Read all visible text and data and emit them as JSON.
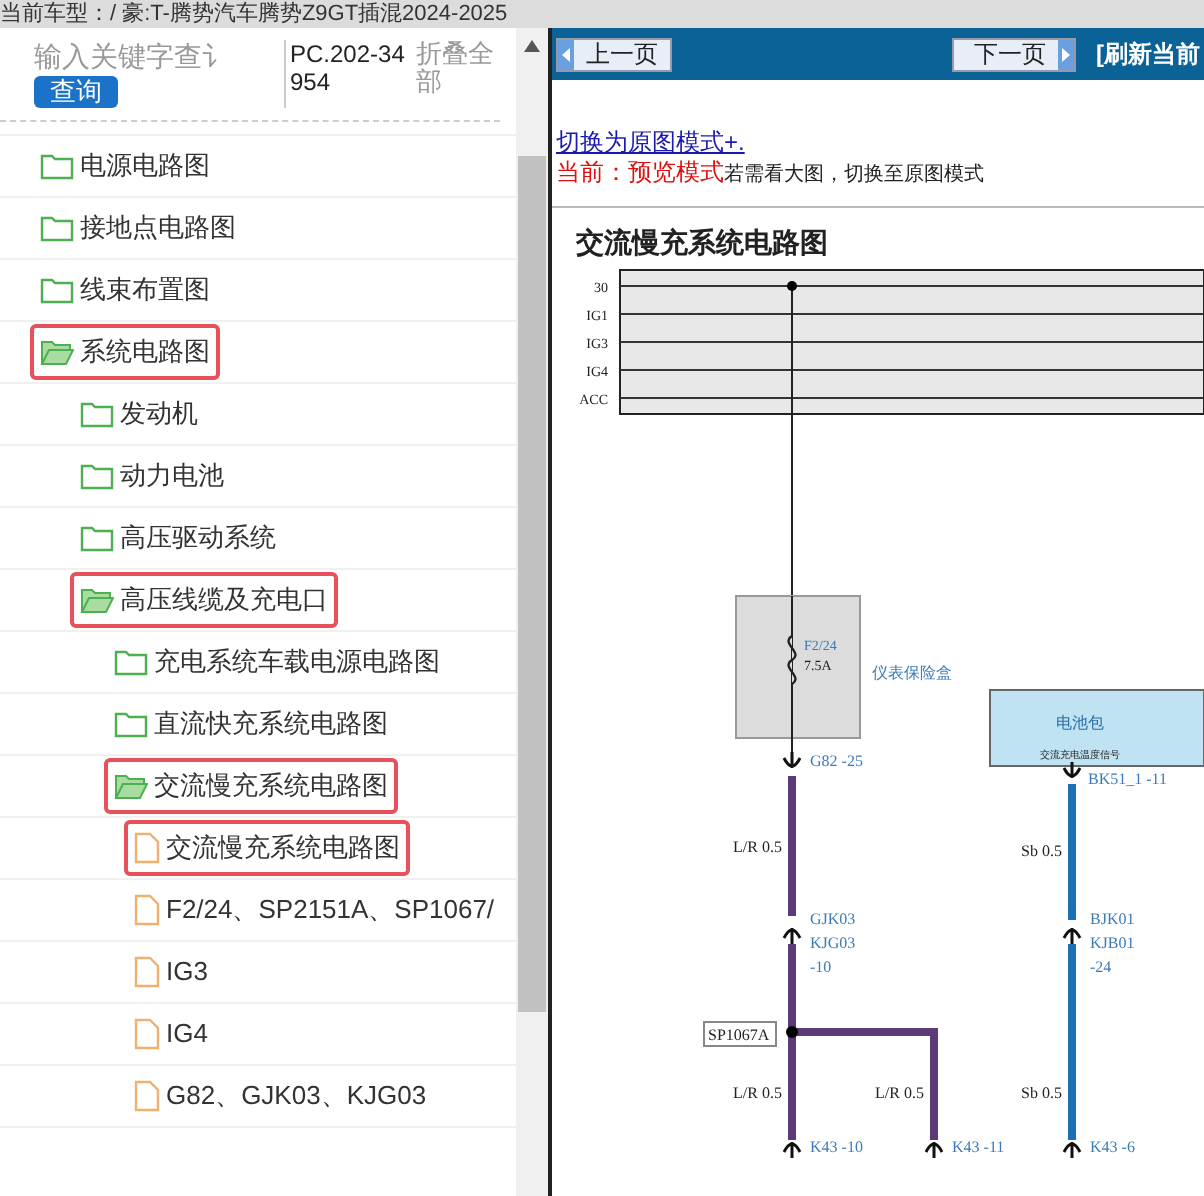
{
  "top_strip": {
    "text": "当前车型：/ 豪:T-腾势汽车腾势Z9GT插混2024-2025"
  },
  "search": {
    "placeholder": "输入关键字查讠",
    "button": "查询",
    "code": "PC.202-34954",
    "collapse": "折叠全部"
  },
  "tree": [
    {
      "label": "电源电路图",
      "kind": "folder",
      "expanded": false,
      "highlighted": false
    },
    {
      "label": "接地点电路图",
      "kind": "folder",
      "expanded": false,
      "highlighted": false
    },
    {
      "label": "线束布置图",
      "kind": "folder",
      "expanded": false,
      "highlighted": false
    },
    {
      "label": "系统电路图",
      "kind": "folder",
      "expanded": true,
      "highlighted": true,
      "children": [
        {
          "label": "发动机",
          "kind": "folder",
          "expanded": false,
          "highlighted": false
        },
        {
          "label": "动力电池",
          "kind": "folder",
          "expanded": false,
          "highlighted": false
        },
        {
          "label": "高压驱动系统",
          "kind": "folder",
          "expanded": false,
          "highlighted": false
        },
        {
          "label": "高压线缆及充电口",
          "kind": "folder",
          "expanded": true,
          "highlighted": true,
          "children": [
            {
              "label": "充电系统车载电源电路图",
              "kind": "folder",
              "expanded": false,
              "highlighted": false
            },
            {
              "label": "直流快充系统电路图",
              "kind": "folder",
              "expanded": false,
              "highlighted": false
            },
            {
              "label": "交流慢充系统电路图",
              "kind": "folder",
              "expanded": true,
              "highlighted": true,
              "children": [
                {
                  "label": "交流慢充系统电路图",
                  "kind": "file",
                  "highlighted": true
                },
                {
                  "label": "F2/24、SP2151A、SP1067/",
                  "kind": "file",
                  "highlighted": false
                },
                {
                  "label": "IG3",
                  "kind": "file",
                  "highlighted": false
                },
                {
                  "label": "IG4",
                  "kind": "file",
                  "highlighted": false
                },
                {
                  "label": "G82、GJK03、KJG03",
                  "kind": "file",
                  "highlighted": false
                }
              ]
            }
          ]
        }
      ]
    }
  ],
  "nav": {
    "prev": "上一页",
    "next": "下一页",
    "refresh": "[刷新当前"
  },
  "mode_link": "切换为原图模式+.",
  "mode_status": {
    "label": "当前：预览模式",
    "hint": "若需看大图，切换至原图模式"
  },
  "diagram": {
    "title": "交流慢充系统电路图",
    "rails": [
      "30",
      "IG1",
      "IG3",
      "IG4",
      "ACC"
    ],
    "fuse": {
      "name": "F2/24",
      "rating": "7.5A",
      "box": "仪表保险盒"
    },
    "battery": {
      "name": "电池包",
      "signal": "交流充电温度信号"
    },
    "labels": [
      {
        "text": "G82  -25",
        "kind": "connector"
      },
      {
        "text": "BK51_1  -11",
        "kind": "connector"
      },
      {
        "text": "L/R 0.5",
        "kind": "wire"
      },
      {
        "text": "Sb 0.5",
        "kind": "wire"
      },
      {
        "text": "GJK03",
        "kind": "connector"
      },
      {
        "text": "KJG03",
        "kind": "connector"
      },
      {
        "text": "-10",
        "kind": "connector"
      },
      {
        "text": "BJK01",
        "kind": "connector"
      },
      {
        "text": "KJB01",
        "kind": "connector"
      },
      {
        "text": "-24",
        "kind": "connector"
      },
      {
        "text": "SP1067A",
        "kind": "splice"
      },
      {
        "text": "L/R 0.5",
        "kind": "wire"
      },
      {
        "text": "L/R 0.5",
        "kind": "wire"
      },
      {
        "text": "Sb 0.5",
        "kind": "wire"
      },
      {
        "text": "K43  -10",
        "kind": "connector"
      },
      {
        "text": "K43  -11",
        "kind": "connector"
      },
      {
        "text": "K43  -6",
        "kind": "connector"
      }
    ]
  }
}
